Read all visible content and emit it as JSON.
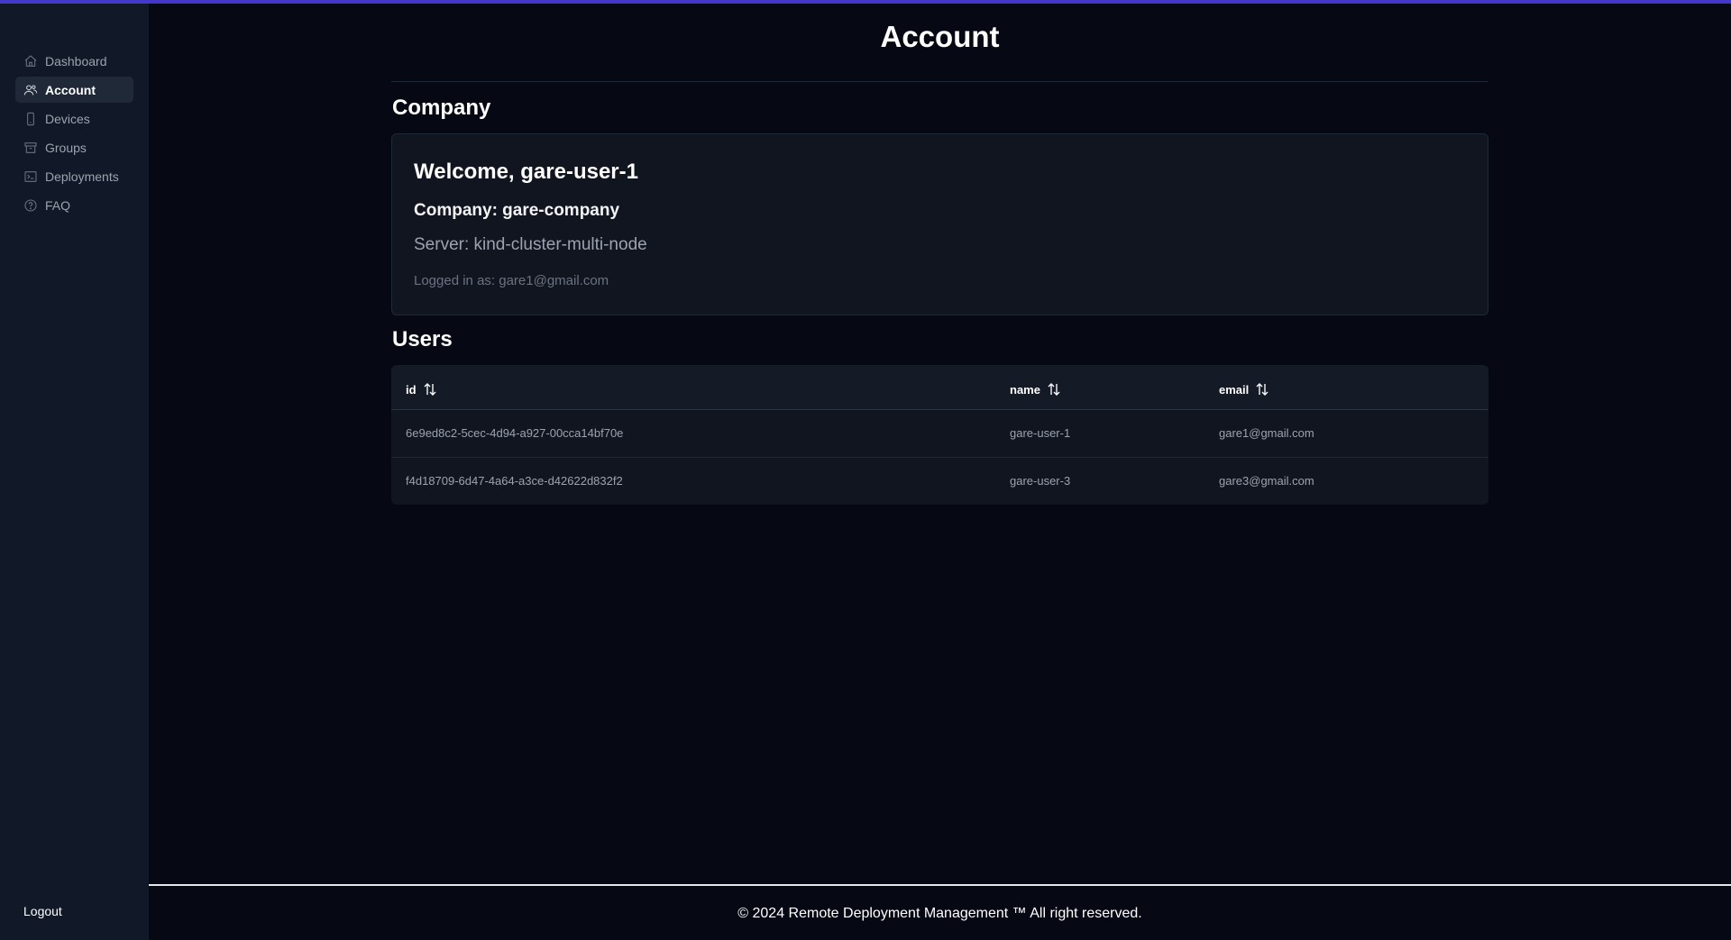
{
  "sidebar": {
    "items": [
      {
        "label": "Dashboard",
        "icon": "home-icon"
      },
      {
        "label": "Account",
        "icon": "users-icon",
        "active": true
      },
      {
        "label": "Devices",
        "icon": "device-icon"
      },
      {
        "label": "Groups",
        "icon": "archive-icon"
      },
      {
        "label": "Deployments",
        "icon": "terminal-icon"
      },
      {
        "label": "FAQ",
        "icon": "question-icon"
      }
    ],
    "logout": "Logout"
  },
  "page": {
    "title": "Account"
  },
  "company": {
    "section_title": "Company",
    "welcome": "Welcome, gare-user-1",
    "company_line": "Company: gare-company",
    "server_line": "Server: kind-cluster-multi-node",
    "logged_line": "Logged in as: gare1@gmail.com"
  },
  "users": {
    "section_title": "Users",
    "columns": [
      "id",
      "name",
      "email"
    ],
    "rows": [
      {
        "id": "6e9ed8c2-5cec-4d94-a927-00cca14bf70e",
        "name": "gare-user-1",
        "email": "gare1@gmail.com"
      },
      {
        "id": "f4d18709-6d47-4a64-a3ce-d42622d832f2",
        "name": "gare-user-3",
        "email": "gare3@gmail.com"
      }
    ]
  },
  "footer": {
    "text": "© 2024 Remote Deployment Management ™ All right reserved."
  },
  "colors": {
    "accent": "#4338ca",
    "background": "#060913",
    "sidebar": "#111827"
  }
}
